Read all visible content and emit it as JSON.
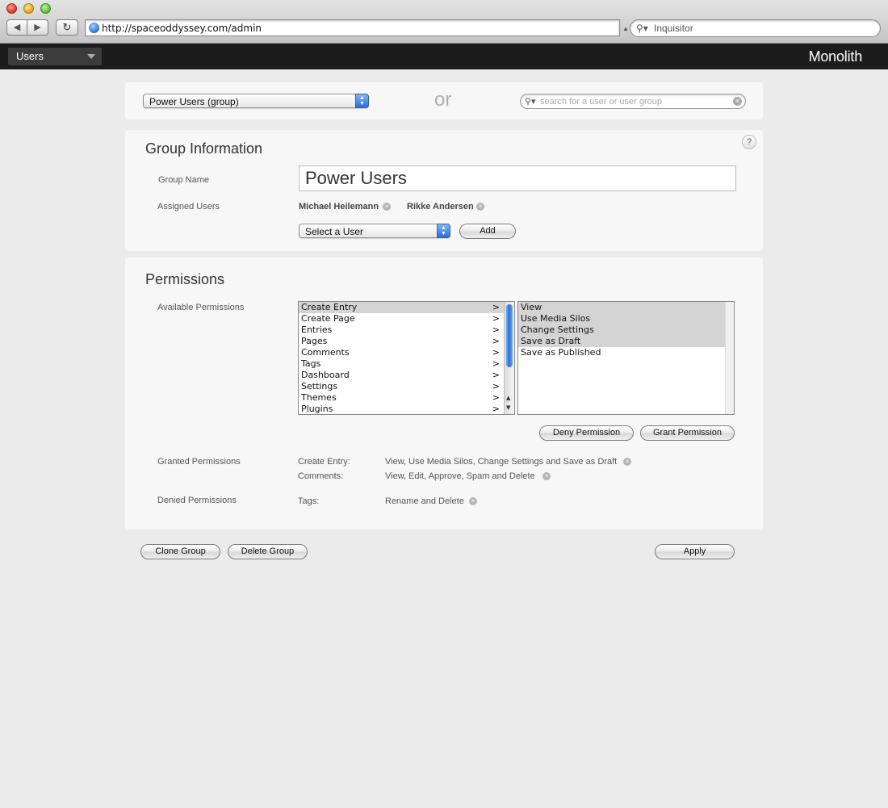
{
  "browser": {
    "url": "http://spaceoddyssey.com/admin",
    "search_placeholder": "Inquisitor"
  },
  "app": {
    "section_menu": "Users",
    "brand": "Monolith"
  },
  "group_selector": {
    "selected": "Power Users (group)",
    "or_text": "or",
    "search_placeholder": "search for a user or user group"
  },
  "group_info": {
    "title": "Group Information",
    "help": "?",
    "name_label": "Group Name",
    "name_value": "Power Users",
    "assigned_label": "Assigned Users",
    "assigned_users": [
      "Michael Heilemann",
      "Rikke Andersen"
    ],
    "select_user": "Select a User",
    "add_label": "Add"
  },
  "permissions": {
    "title": "Permissions",
    "available_label": "Available Permissions",
    "available": [
      "Create Entry",
      "Create Page",
      "Entries",
      "Pages",
      "Comments",
      "Tags",
      "Dashboard",
      "Settings",
      "Themes",
      "Plugins"
    ],
    "chevron": ">",
    "actions": [
      "View",
      "Use Media Silos",
      "Change Settings",
      "Save as Draft",
      "Save as Published"
    ],
    "deny_label": "Deny Permission",
    "grant_label": "Grant Permission",
    "granted_label": "Granted Permissions",
    "granted": [
      {
        "key": "Create Entry:",
        "value": "View, Use Media Silos, Change Settings and Save as Draft"
      },
      {
        "key": "Comments:",
        "value": "View, Edit, Approve, Spam and Delete"
      }
    ],
    "denied_label": "Denied Permissions",
    "denied": [
      {
        "key": "Tags:",
        "value": "Rename and Delete"
      }
    ]
  },
  "footer": {
    "clone_label": "Clone Group",
    "delete_label": "Delete Group",
    "apply_label": "Apply"
  }
}
